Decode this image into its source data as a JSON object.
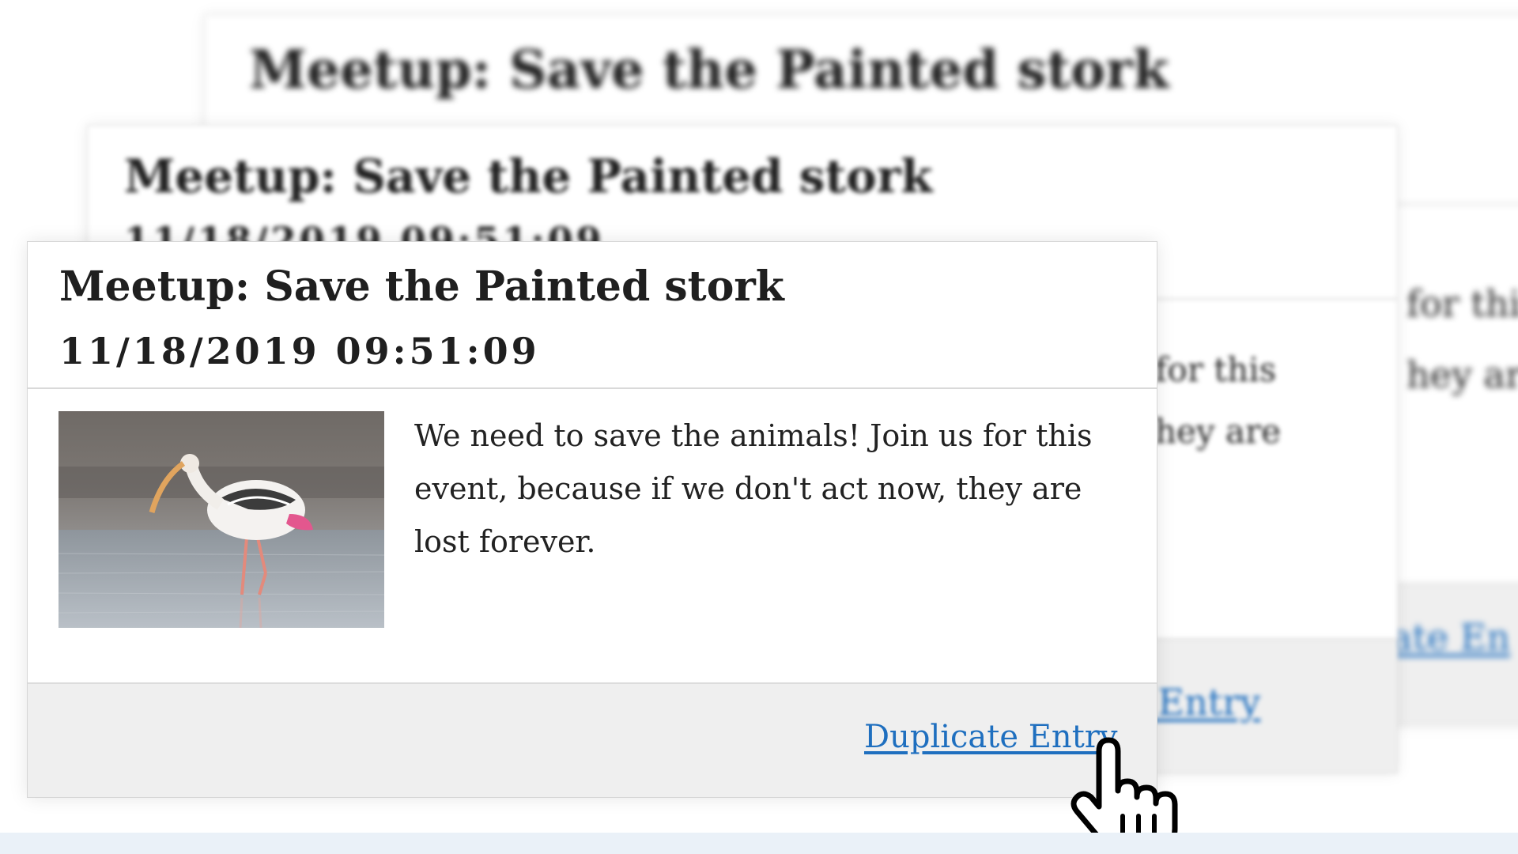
{
  "cards": [
    {
      "title": "Meetup: Save the Painted stork",
      "description_fragment": "for this\nhey are",
      "link_label": "ate En"
    },
    {
      "title": "Meetup: Save the Painted stork",
      "date_fragment": "11/18/2019 09:51:09",
      "description_fragment": "for this\nhey are",
      "link_label": "cate Entry"
    }
  ],
  "front_card": {
    "title": "Meetup: Save the Painted stork",
    "date": "11/18/2019 09:51:09",
    "description": "We need to save the animals! Join us for this event, because if we don't act now, they are lost forever.",
    "image": "painted-stork-photo",
    "link_label": "Duplicate Entry"
  },
  "colors": {
    "link": "#1f6fbf",
    "footer_bg": "#efefef",
    "bottom_strip": "#eaf1f8"
  },
  "icons": {
    "cursor": "hand-pointer-icon"
  }
}
